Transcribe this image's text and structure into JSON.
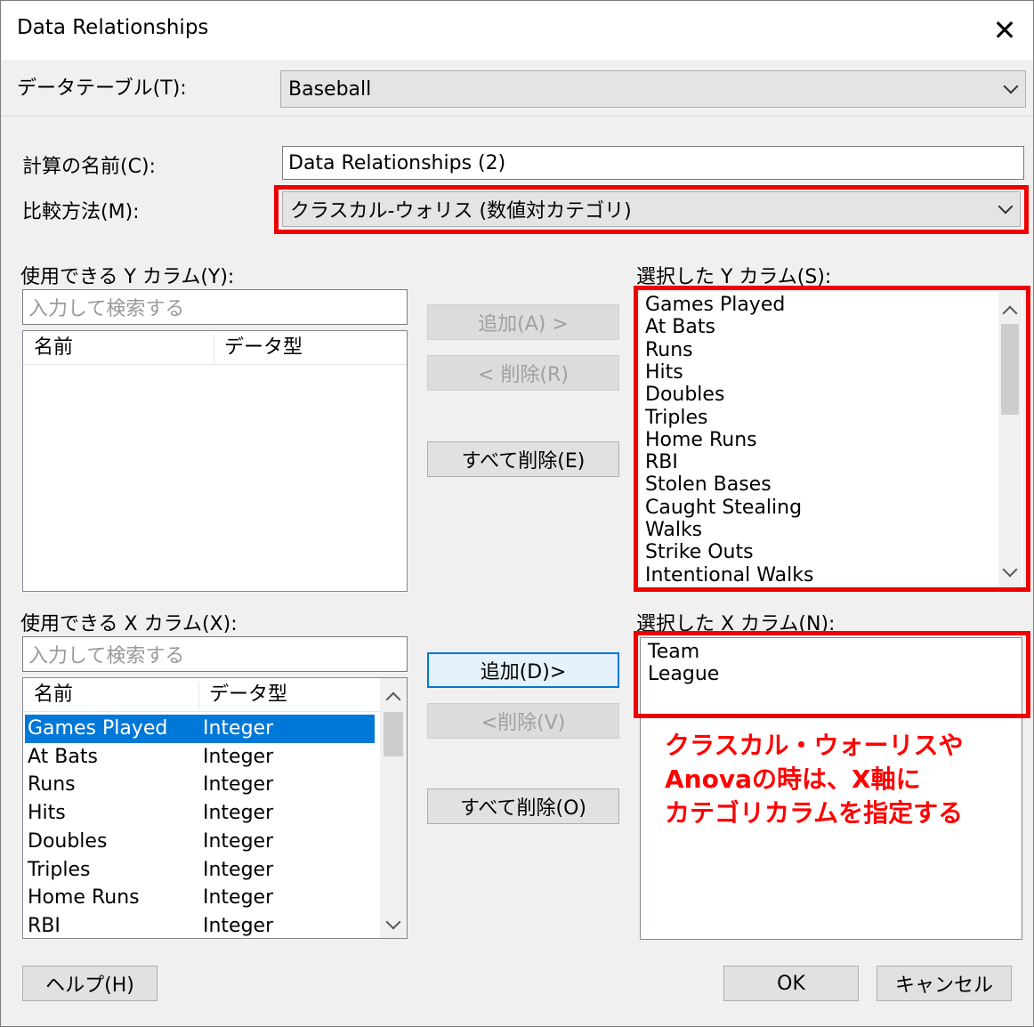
{
  "window": {
    "title": "Data Relationships"
  },
  "data_table": {
    "label": "データテーブル(T):",
    "value": "Baseball"
  },
  "calc_name": {
    "label": "計算の名前(C):",
    "value": "Data Relationships (2)"
  },
  "compare_method": {
    "label": "比較方法(M):",
    "value": "クラスカル-ウォリス (数値対カテゴリ)"
  },
  "available_y": {
    "label": "使用できる Y カラム(Y):",
    "search_placeholder": "入力して検索する",
    "columns": [
      "名前",
      "データ型"
    ],
    "rows": []
  },
  "available_x": {
    "label": "使用できる X カラム(X):",
    "search_placeholder": "入力して検索する",
    "columns": [
      "名前",
      "データ型"
    ],
    "rows": [
      {
        "name": "Games Played",
        "type": "Integer",
        "selected": true
      },
      {
        "name": "At Bats",
        "type": "Integer"
      },
      {
        "name": "Runs",
        "type": "Integer"
      },
      {
        "name": "Hits",
        "type": "Integer"
      },
      {
        "name": "Doubles",
        "type": "Integer"
      },
      {
        "name": "Triples",
        "type": "Integer"
      },
      {
        "name": "Home Runs",
        "type": "Integer"
      },
      {
        "name": "RBI",
        "type": "Integer"
      }
    ]
  },
  "y_buttons": {
    "add": "追加(A) >",
    "remove": "< 削除(R)",
    "remove_all": "すべて削除(E)"
  },
  "x_buttons": {
    "add": "追加(D)>",
    "remove": "<削除(V)",
    "remove_all": "すべて削除(O)"
  },
  "selected_y": {
    "label": "選択した Y カラム(S):",
    "items": [
      "Games Played",
      "At Bats",
      "Runs",
      "Hits",
      "Doubles",
      "Triples",
      "Home Runs",
      "RBI",
      "Stolen Bases",
      "Caught Stealing",
      "Walks",
      "Strike Outs",
      "Intentional Walks"
    ]
  },
  "selected_x": {
    "label": "選択した X カラム(N):",
    "items": [
      "Team",
      "League"
    ]
  },
  "annotation": {
    "lines": [
      "クラスカル・ウォーリスや",
      "Anovaの時は、X軸に",
      "カテゴリカラムを指定する"
    ],
    "color": "#ff0000"
  },
  "footer": {
    "help": "ヘルプ(H)",
    "ok": "OK",
    "cancel": "キャンセル"
  },
  "colors": {
    "highlight": "#ee0000",
    "selection": "#0078d7",
    "dialog_bg": "#f0f0f0"
  }
}
